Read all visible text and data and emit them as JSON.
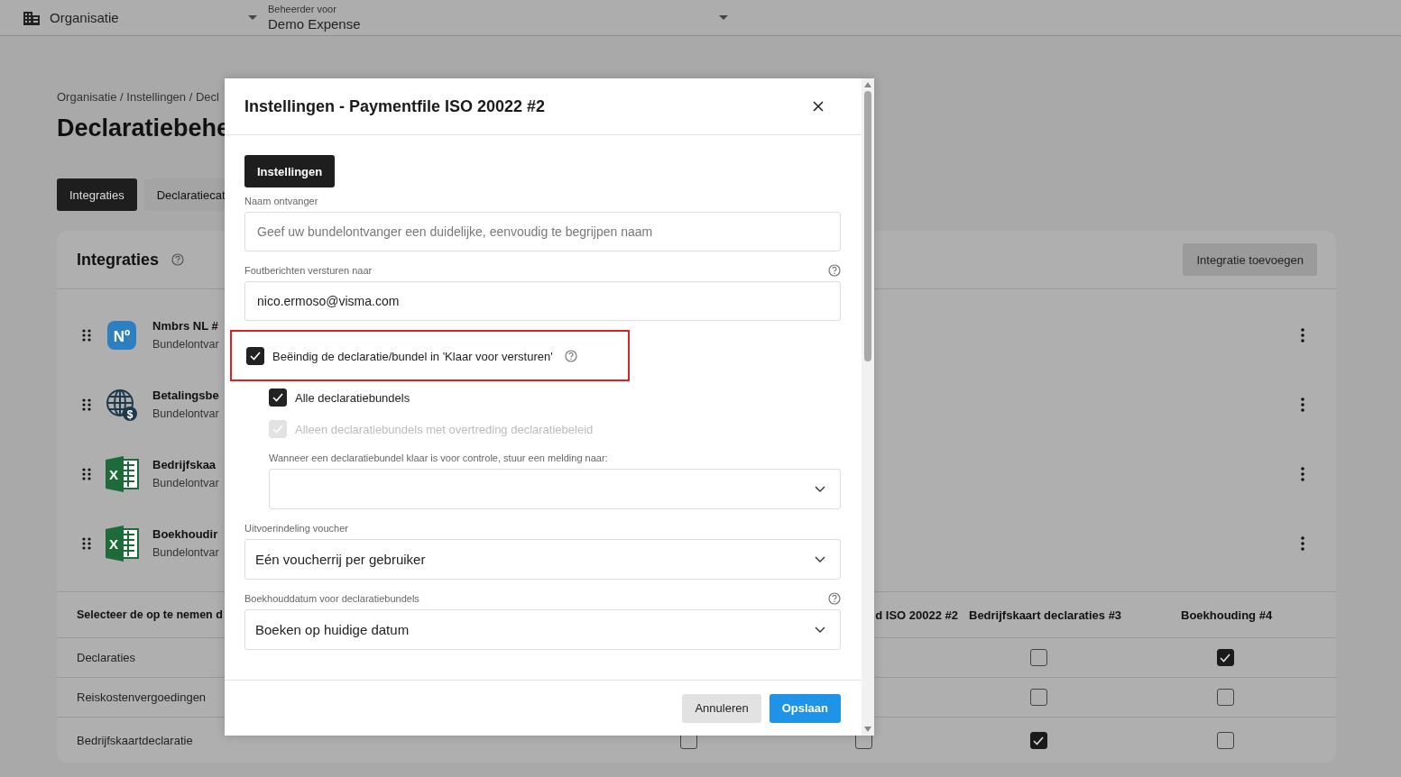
{
  "top_bar": {
    "organisation": "Organisatie",
    "admin_label": "Beheerder voor",
    "admin_value": "Demo Expense"
  },
  "page": {
    "breadcrumb": "Organisatie / Instellingen / Decl",
    "title": "Declaratiebehe",
    "tabs": [
      {
        "label": "Integraties",
        "selected": true
      },
      {
        "label": "Declaratiecat",
        "selected": false
      }
    ]
  },
  "card": {
    "title": "Integraties",
    "add_button": "Integratie toevoegen",
    "integrations": [
      {
        "kind": "nmbrs",
        "logo_text": "Nº",
        "name": "Nmbrs NL #",
        "subtitle": "Bundelontvar"
      },
      {
        "kind": "globe",
        "logo_text": "$",
        "name": "Betalingsbe",
        "subtitle": "Bundelontvar"
      },
      {
        "kind": "excel",
        "logo_text": "X",
        "name": "Bedrijfskaa",
        "subtitle": "Bundelontvar"
      },
      {
        "kind": "excel",
        "logo_text": "X",
        "name": "Boekhoudir",
        "subtitle": "Bundelontvar"
      }
    ],
    "table": {
      "columns": [
        "Selecteer de op te nemen d",
        "d ISO 20022 #2",
        "Bedrijfskaart declaraties #3",
        "Boekhouding #4"
      ],
      "rows": [
        {
          "label": "Declaraties",
          "checks": [
            false,
            true
          ]
        },
        {
          "label": "Reiskostenvergoedingen",
          "checks": [
            false,
            false
          ]
        },
        {
          "label": "Bedrijfskaartdeclaratie",
          "checks": [
            false,
            false,
            true,
            false
          ]
        }
      ]
    }
  },
  "dialog": {
    "title": "Instellingen - Paymentfile ISO 20022 #2",
    "tab": {
      "label": "Instellingen",
      "selected": true
    },
    "fields": [
      {
        "kind": "text",
        "label": "Naam ontvanger",
        "placeholder": "Geef uw bundelontvanger een duidelijke, eenvoudig te begrijpen naam",
        "help": false
      },
      {
        "kind": "text",
        "label": "Foutberichten versturen naar",
        "value": "nico.ermoso@visma.com",
        "help": true
      },
      {
        "kind": "checkbox",
        "label": "Beëindig de declaratie/bundel in 'Klaar voor versturen'",
        "checked": true,
        "help": true,
        "highlighted": true
      },
      {
        "kind": "sub_checkbox",
        "label": "Alle declaratiebundels",
        "checked": true,
        "disabled": false
      },
      {
        "kind": "sub_checkbox",
        "label": "Alleen declaratiebundels met overtreding declaratiebeleid",
        "checked": true,
        "disabled": true
      },
      {
        "kind": "sub_select",
        "label": "Wanneer een declaratiebundel klaar is voor controle, stuur een melding naar:"
      },
      {
        "kind": "select",
        "label": "Uitvoerindeling voucher",
        "value": "Eén voucherrij per gebruiker",
        "help": false
      },
      {
        "kind": "select",
        "label": "Boekhouddatum voor declaratiebundels",
        "value": "Boeken op huidige datum",
        "help": true
      }
    ],
    "buttons": [
      {
        "kind": "secondary",
        "label": "Annuleren"
      },
      {
        "kind": "primary",
        "label": "Opslaan"
      }
    ]
  }
}
